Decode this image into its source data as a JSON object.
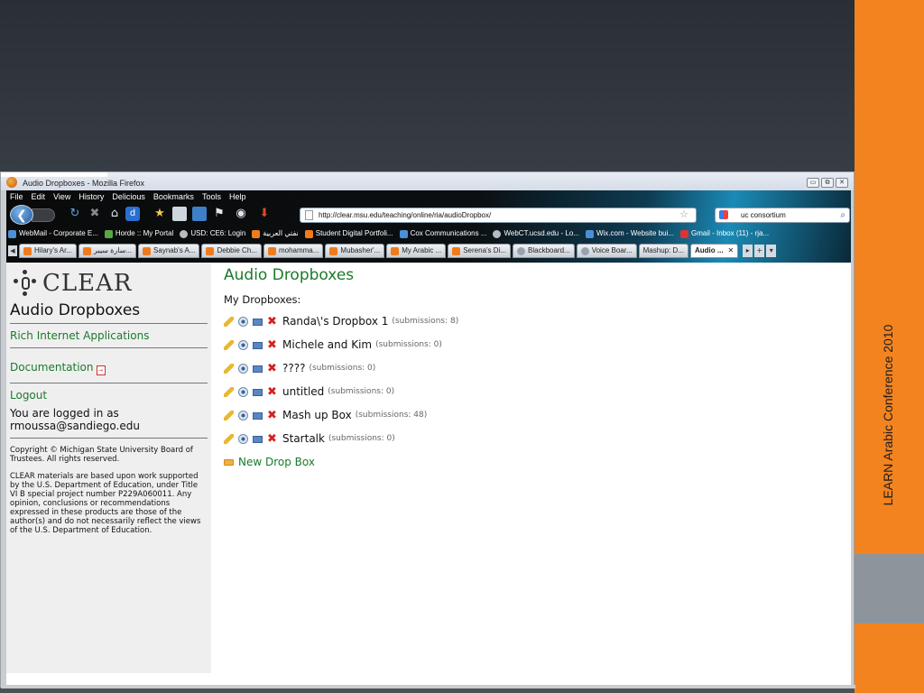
{
  "slide": {
    "side_text": "LEARN Arabic Conference 2010",
    "accent_color": "#f3831f"
  },
  "window": {
    "title": "Audio Dropboxes - Mozilla Firefox",
    "buttons": [
      "▭",
      "⧉",
      "✕"
    ]
  },
  "menu": [
    "File",
    "Edit",
    "View",
    "History",
    "Delicious",
    "Bookmarks",
    "Tools",
    "Help"
  ],
  "url": "http://clear.msu.edu/teaching/online/ria/audioDropbox/",
  "search_value": "uc consortium",
  "bookmarks": [
    {
      "label": "WebMail - Corporate E...",
      "icon": "blue"
    },
    {
      "label": "Horde :: My Portal",
      "icon": "green"
    },
    {
      "label": "USD: CE6: Login",
      "icon": "gray"
    },
    {
      "label": "نفتي العربية",
      "icon": "orange"
    },
    {
      "label": "Student Digital Portfoli...",
      "icon": "orange"
    },
    {
      "label": "Cox Communications ...",
      "icon": "blue"
    },
    {
      "label": "WebCT.ucsd.edu - Lo...",
      "icon": "gray"
    },
    {
      "label": "Wix.com - Website bui...",
      "icon": "blue"
    },
    {
      "label": "Gmail - Inbox (11) - rja...",
      "icon": "red"
    }
  ],
  "tabs": [
    {
      "label": "Hilary's Ar...",
      "icon": "orange"
    },
    {
      "label": "سارة سيبر...",
      "icon": "orange"
    },
    {
      "label": "Saynab's A...",
      "icon": "orange"
    },
    {
      "label": "Debbie Ch...",
      "icon": "orange"
    },
    {
      "label": "mohamma...",
      "icon": "orange"
    },
    {
      "label": "Mubasher'...",
      "icon": "orange"
    },
    {
      "label": "My Arabic ...",
      "icon": "orange"
    },
    {
      "label": "Serena's Di...",
      "icon": "orange"
    },
    {
      "label": "Blackboard...",
      "icon": "gray"
    },
    {
      "label": "Voice Boar...",
      "icon": "gray"
    },
    {
      "label": "Mashup: D...",
      "icon": "page"
    },
    {
      "label": "Audio ...",
      "icon": "page",
      "active": true
    }
  ],
  "sidebar": {
    "logo_text": "CLEAR",
    "heading": "Audio Dropboxes",
    "link_ria": "Rich Internet Applications",
    "link_docs": "Documentation",
    "link_logout": "Logout",
    "logged_in_line1": "You are logged in as",
    "logged_in_line2": "rmoussa@sandiego.edu",
    "copyright": "Copyright © Michigan State University Board of Trustees. All rights reserved.",
    "clear_note": "CLEAR materials are based upon work supported by the U.S. Department of Education, under Title VI B special project number P229A060011. Any opinion, conclusions or recommendations expressed in these products are those of the author(s) and do not necessarily reflect the views of the U.S. Department of Education."
  },
  "main": {
    "title": "Audio Dropboxes",
    "subtitle": "My Dropboxes:",
    "dropboxes": [
      {
        "name": "Randa\\'s Dropbox 1",
        "count": "(submissions: 8)"
      },
      {
        "name": "Michele and Kim",
        "count": "(submissions: 0)"
      },
      {
        "name": "????",
        "count": "(submissions: 0)"
      },
      {
        "name": "untitled",
        "count": "(submissions: 0)"
      },
      {
        "name": "Mash up Box",
        "count": "(submissions: 48)"
      },
      {
        "name": "Startalk",
        "count": "(submissions: 0)"
      }
    ],
    "new_box": "New Drop Box"
  }
}
